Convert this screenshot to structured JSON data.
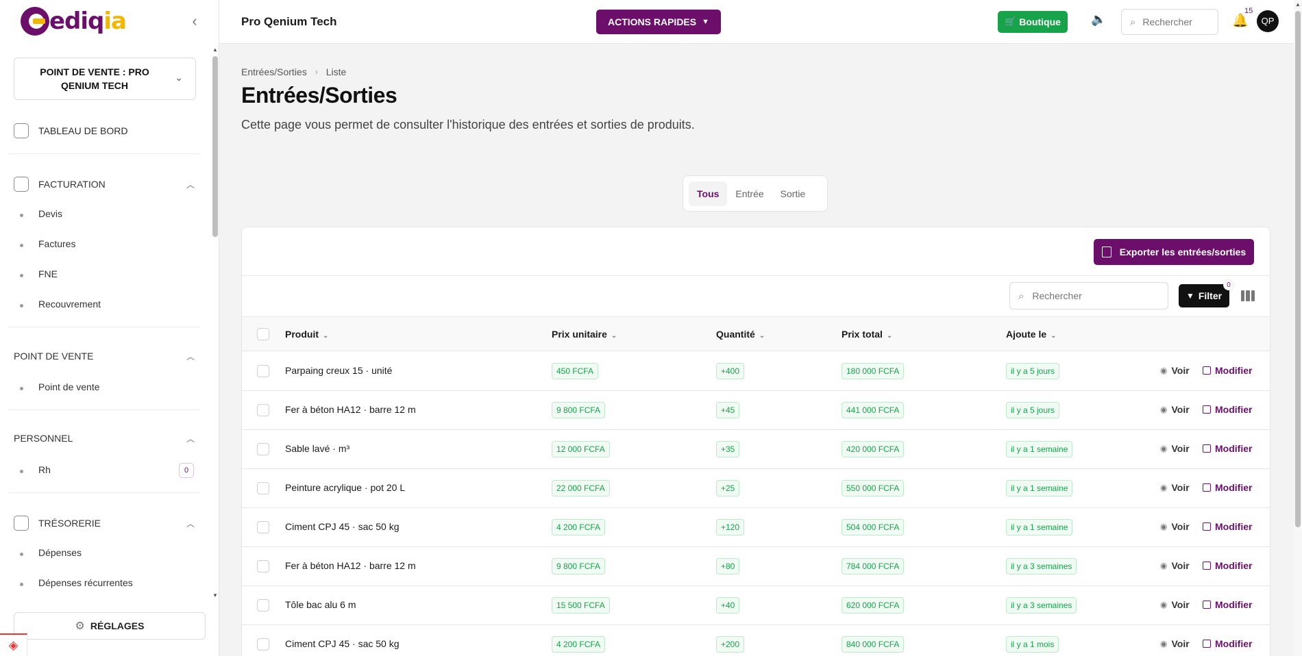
{
  "sidebar": {
    "logo": "ediqia",
    "point_of_sale": "POINT DE VENTE : PRO QENIUM TECH",
    "dashboard": "TABLEAU DE BORD",
    "sections": [
      {
        "title": "FACTURATION",
        "items": [
          "Devis",
          "Factures",
          "FNE",
          "Recouvrement"
        ]
      },
      {
        "title": "POINT DE VENTE",
        "items": [
          "Point de vente"
        ]
      },
      {
        "title": "PERSONNEL",
        "items": [
          "Rh"
        ],
        "badge": "0"
      },
      {
        "title": "TRÉSORERIE",
        "items": [
          "Dépenses",
          "Dépenses récurrentes"
        ]
      }
    ],
    "settings": "RÉGLAGES"
  },
  "topbar": {
    "store_name": "Pro Qenium Tech",
    "quick_actions": "ACTIONS RAPIDES",
    "shop": "Boutique",
    "search_placeholder": "Rechercher",
    "notifications": "15",
    "avatar": "QP"
  },
  "page": {
    "breadcrumb": [
      "Entrées/Sorties",
      "Liste"
    ],
    "title": "Entrées/Sorties",
    "description": "Cette page vous permet de consulter l'historique des entrées et sorties de produits.",
    "tabs": [
      "Tous",
      "Entrée",
      "Sortie"
    ],
    "active_tab": "Tous"
  },
  "table": {
    "export_label": "Exporter les entrées/sorties",
    "search_placeholder": "Rechercher",
    "filter_label": "Filter",
    "filter_count": "0",
    "columns": [
      "Produit",
      "Prix unitaire",
      "Quantité",
      "Prix total",
      "Ajoute le"
    ],
    "view_label": "Voir",
    "edit_label": "Modifier",
    "rows": [
      {
        "product": "Parpaing creux 15 · unité",
        "unit_price": "450 FCFA",
        "qty": "+400",
        "total": "180 000 FCFA",
        "added": "il y a 5 jours"
      },
      {
        "product": "Fer à béton HA12 · barre 12 m",
        "unit_price": "9 800 FCFA",
        "qty": "+45",
        "total": "441 000 FCFA",
        "added": "il y a 5 jours"
      },
      {
        "product": "Sable lavé · m³",
        "unit_price": "12 000 FCFA",
        "qty": "+35",
        "total": "420 000 FCFA",
        "added": "il y a 1 semaine"
      },
      {
        "product": "Peinture acrylique · pot 20 L",
        "unit_price": "22 000 FCFA",
        "qty": "+25",
        "total": "550 000 FCFA",
        "added": "il y a 1 semaine"
      },
      {
        "product": "Ciment CPJ 45 · sac 50 kg",
        "unit_price": "4 200 FCFA",
        "qty": "+120",
        "total": "504 000 FCFA",
        "added": "il y a 1 semaine"
      },
      {
        "product": "Fer à béton HA12 · barre 12 m",
        "unit_price": "9 800 FCFA",
        "qty": "+80",
        "total": "784 000 FCFA",
        "added": "il y a 3 semaines"
      },
      {
        "product": "Tôle bac alu 6 m",
        "unit_price": "15 500 FCFA",
        "qty": "+40",
        "total": "620 000 FCFA",
        "added": "il y a 3 semaines"
      },
      {
        "product": "Ciment CPJ 45 · sac 50 kg",
        "unit_price": "4 200 FCFA",
        "qty": "+200",
        "total": "840 000 FCFA",
        "added": "il y a 1 mois"
      }
    ]
  },
  "colors": {
    "brand": "#6b0f6b",
    "accent": "#f2b700",
    "success": "#17a34a"
  }
}
